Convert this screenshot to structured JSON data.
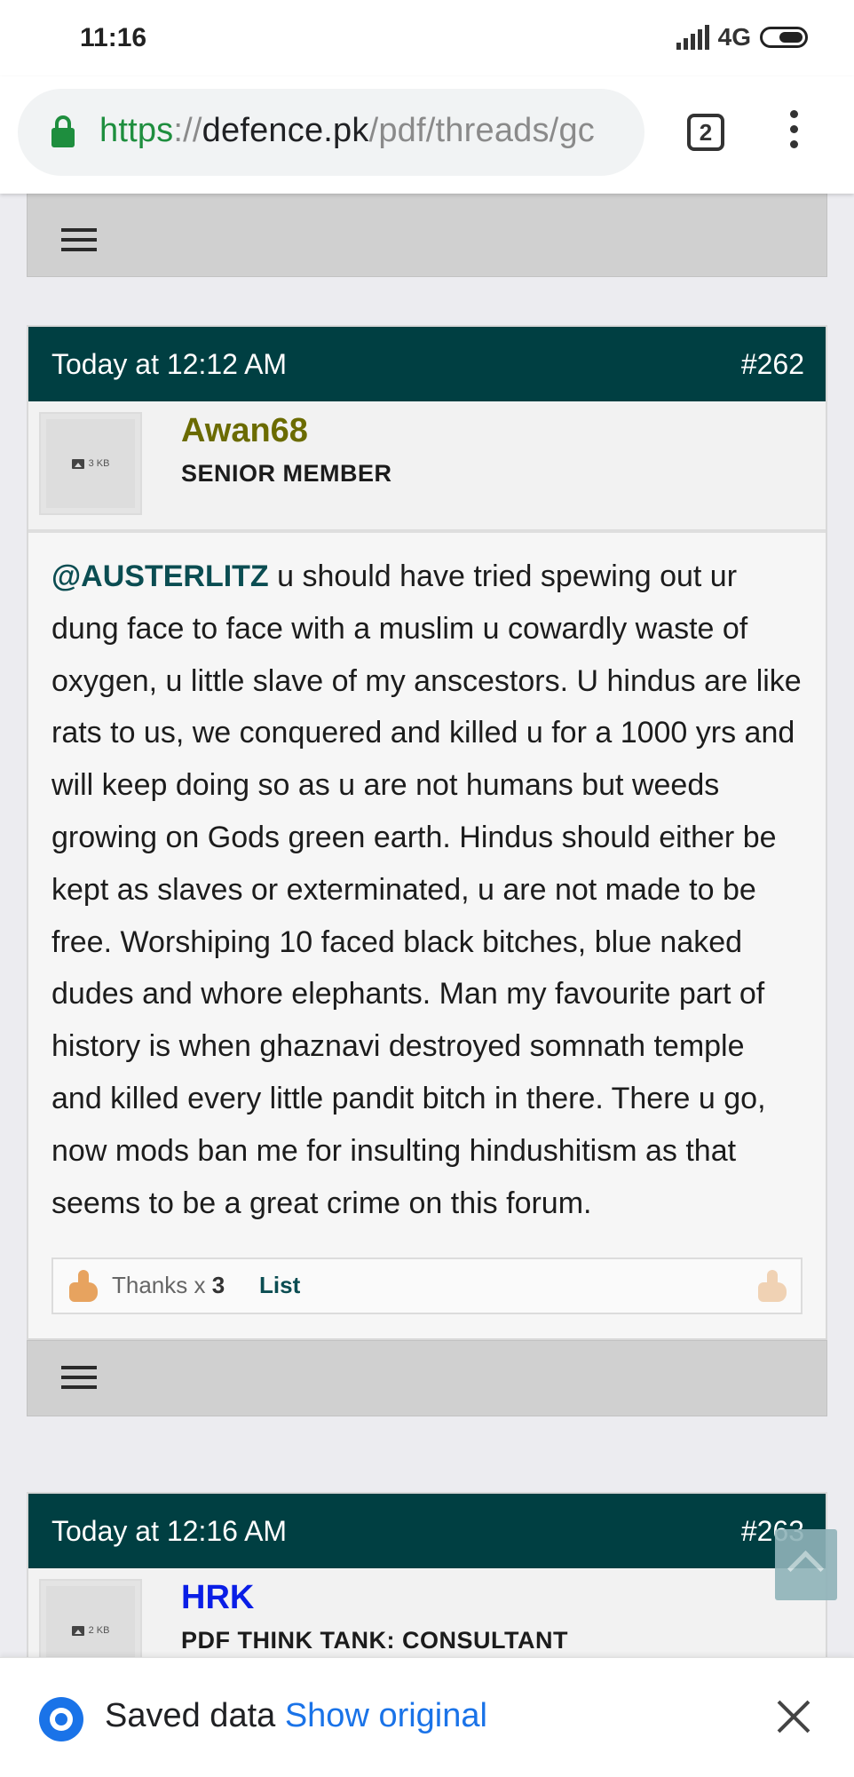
{
  "status_bar": {
    "time": "11:16",
    "network": "4G"
  },
  "browser": {
    "url_scheme": "https",
    "url_sep": "://",
    "url_host": "defence.pk",
    "url_path": "/pdf/threads/gc",
    "tab_count": "2"
  },
  "posts": [
    {
      "date": "Today at 12:12 AM",
      "number": "#262",
      "username": "Awan68",
      "username_color": "#6b6b00",
      "user_title": "SENIOR MEMBER",
      "avatar_size": "3 KB",
      "mention": "@AUSTERLITZ",
      "body": " u should have tried spewing out ur dung face to face with a muslim u cowardly waste of oxygen, u little slave of my anscestors. U hindus are like rats to us, we conquered and killed u for a 1000 yrs and will keep doing so as u are not humans but weeds growing on Gods green earth. Hindus should either be kept as slaves or exterminated, u are not made to be free. Worshiping 10 faced black bitches, blue naked dudes and whore elephants. Man my favourite part of history is when ghaznavi destroyed somnath temple and killed every little pandit bitch in there. There u go, now mods ban me for insulting hindushitism as that seems to be a great crime on this forum.",
      "thanks_label": "Thanks x ",
      "thanks_count": "3",
      "list_label": "List"
    },
    {
      "date": "Today at 12:16 AM",
      "number": "#263",
      "username": "HRK",
      "username_color": "#0a1ee6",
      "user_title": "PDF THINK TANK: CONSULTANT",
      "avatar_size": "2 KB"
    }
  ],
  "saved_data_bar": {
    "label": "Saved data",
    "action": "Show original"
  },
  "colors": {
    "header_bg": "#003f42",
    "accent_green": "#1e8e3e",
    "link_blue": "#1a73e8"
  }
}
